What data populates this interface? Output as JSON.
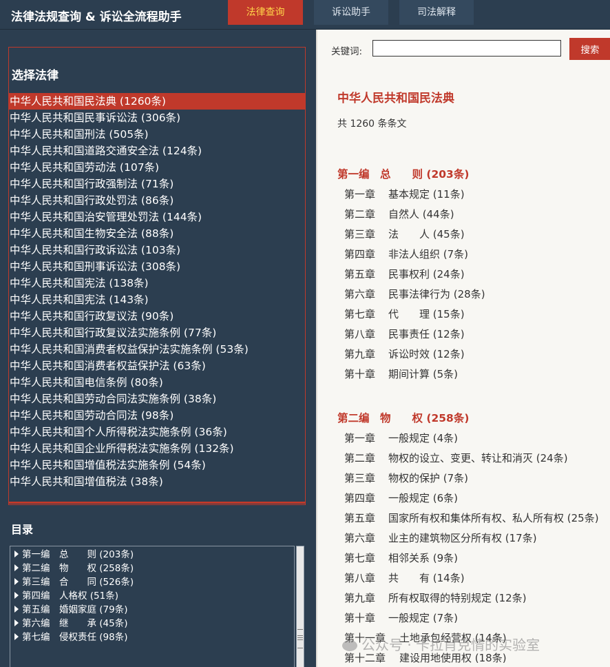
{
  "header": {
    "title": "法律法规查询 & 诉讼全流程助手",
    "tabs": [
      "法律查询",
      "诉讼助手",
      "司法解释"
    ]
  },
  "sidebar": {
    "law_heading": "选择法律",
    "laws": [
      "中华人民共和国民法典 (1260条)",
      "中华人民共和国民事诉讼法 (306条)",
      "中华人民共和国刑法 (505条)",
      "中华人民共和国道路交通安全法 (124条)",
      "中华人民共和国劳动法 (107条)",
      "中华人民共和国行政强制法 (71条)",
      "中华人民共和国行政处罚法 (86条)",
      "中华人民共和国治安管理处罚法 (144条)",
      "中华人民共和国生物安全法 (88条)",
      "中华人民共和国行政诉讼法 (103条)",
      "中华人民共和国刑事诉讼法 (308条)",
      "中华人民共和国宪法 (138条)",
      "中华人民共和国宪法 (143条)",
      "中华人民共和国行政复议法 (90条)",
      "中华人民共和国行政复议法实施条例 (77条)",
      "中华人民共和国消费者权益保护法实施条例 (53条)",
      "中华人民共和国消费者权益保护法 (63条)",
      "中华人民共和国电信条例 (80条)",
      "中华人民共和国劳动合同法实施条例 (38条)",
      "中华人民共和国劳动合同法 (98条)",
      "中华人民共和国个人所得税法实施条例 (36条)",
      "中华人民共和国企业所得税法实施条例 (132条)",
      "中华人民共和国增值税法实施条例 (54条)",
      "中华人民共和国增值税法 (38条)"
    ],
    "toc_heading": "目录",
    "toc": [
      "第一编　总　　则 (203条)",
      "第二编　物　　权 (258条)",
      "第三编　合　　同 (526条)",
      "第四编　人格权 (51条)",
      "第五编　婚姻家庭 (79条)",
      "第六编　继　　承 (45条)",
      "第七编　侵权责任 (98条)"
    ]
  },
  "main": {
    "keyword_label": "关键词:",
    "keyword_value": "",
    "search_label": "搜索",
    "law_title": "中华人民共和国民法典",
    "law_count": "共 1260 条条文",
    "parts": [
      {
        "title": "第一编　总　　则 (203条)",
        "chapters": [
          {
            "num": "第一章",
            "name": "基本规定 (11条)"
          },
          {
            "num": "第二章",
            "name": "自然人 (44条)"
          },
          {
            "num": "第三章",
            "name": "法　　人 (45条)"
          },
          {
            "num": "第四章",
            "name": "非法人组织 (7条)"
          },
          {
            "num": "第五章",
            "name": "民事权利 (24条)"
          },
          {
            "num": "第六章",
            "name": "民事法律行为 (28条)"
          },
          {
            "num": "第七章",
            "name": "代　　理 (15条)"
          },
          {
            "num": "第八章",
            "name": "民事责任 (12条)"
          },
          {
            "num": "第九章",
            "name": "诉讼时效 (12条)"
          },
          {
            "num": "第十章",
            "name": "期间计算 (5条)"
          }
        ]
      },
      {
        "title": "第二编　物　　权 (258条)",
        "chapters": [
          {
            "num": "第一章",
            "name": "一般规定 (4条)"
          },
          {
            "num": "第二章",
            "name": "物权的设立、变更、转让和消灭 (24条)"
          },
          {
            "num": "第三章",
            "name": "物权的保护 (7条)"
          },
          {
            "num": "第四章",
            "name": "一般规定 (6条)"
          },
          {
            "num": "第五章",
            "name": "国家所有权和集体所有权、私人所有权 (25条)"
          },
          {
            "num": "第六章",
            "name": "业主的建筑物区分所有权 (17条)"
          },
          {
            "num": "第七章",
            "name": "相邻关系 (9条)"
          },
          {
            "num": "第八章",
            "name": "共　　有 (14条)"
          },
          {
            "num": "第九章",
            "name": "所有权取得的特别规定 (12条)"
          },
          {
            "num": "第十章",
            "name": "一般规定 (7条)"
          },
          {
            "num": "第十一章",
            "name": "土地承包经营权 (14条)"
          },
          {
            "num": "第十二章",
            "name": "建设用地使用权 (18条)"
          }
        ]
      }
    ]
  },
  "watermark": "公众号 · 卡拉肖克情的实验室",
  "colors": {
    "accent": "#c0392b",
    "sidebar_bg": "#2c3e50",
    "content_bg": "#f8f7f3",
    "active_tab_text": "#ffd54a"
  }
}
